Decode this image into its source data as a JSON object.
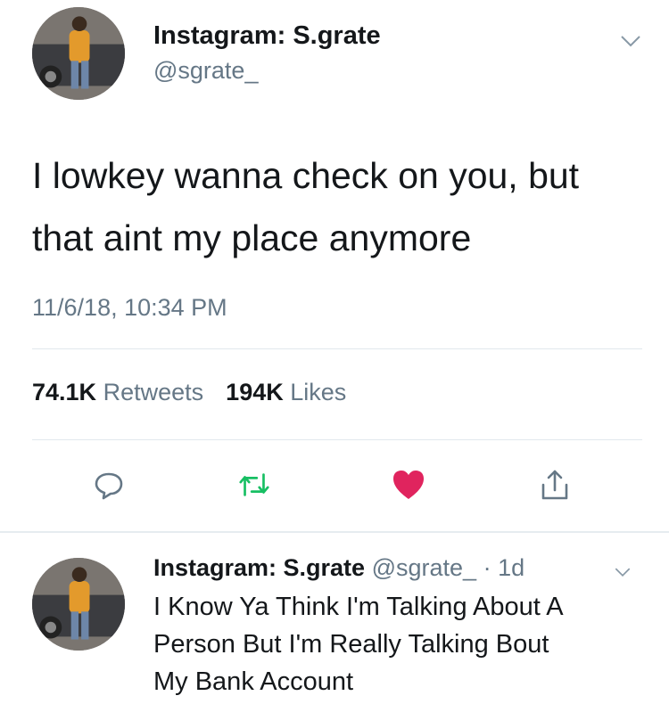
{
  "tweet": {
    "display_name": "Instagram: S.grate",
    "handle": "@sgrate_",
    "text_line1": "I lowkey wanna check on you, but",
    "text_line2": "that aint my place anymore",
    "timestamp": "11/6/18, 10:34 PM",
    "retweets_count": "74.1K",
    "retweets_label": "Retweets",
    "likes_count": "194K",
    "likes_label": "Likes"
  },
  "actions": [
    {
      "icon": "reply-icon"
    },
    {
      "icon": "retweet-icon",
      "color": "#17bf63"
    },
    {
      "icon": "like-heart-icon",
      "color": "#e0245e"
    },
    {
      "icon": "share-icon"
    }
  ],
  "reply": {
    "display_name": "Instagram: S.grate",
    "handle": "@sgrate_",
    "separator": "·",
    "age": "1d",
    "line1": "I Know Ya Think I'm Talking About A",
    "line2": "Person But I'm Really Talking Bout",
    "line3": "My Bank Account"
  },
  "colors": {
    "muted": "#657786",
    "divider": "#e1e8ed",
    "retweet_green": "#17bf63",
    "like_red": "#e0245e"
  }
}
